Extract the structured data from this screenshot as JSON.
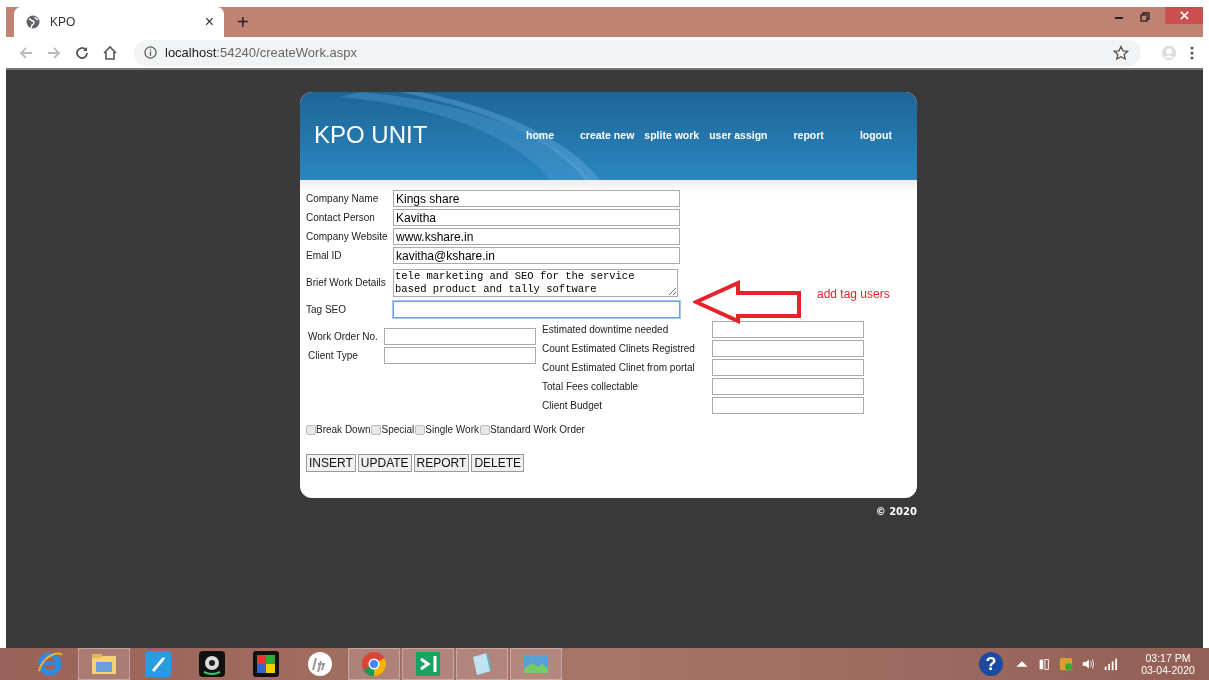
{
  "browser": {
    "tab": {
      "title": "KPO",
      "close": "×"
    },
    "new_tab": "+",
    "address": {
      "host": "localhost",
      "path": ":54240/createWork.aspx"
    }
  },
  "header": {
    "title": "KPO UNIT",
    "nav": [
      {
        "label": "home"
      },
      {
        "label": "create new"
      },
      {
        "label": "splite work"
      },
      {
        "label": "user assign"
      },
      {
        "label": "report"
      },
      {
        "label": "logout"
      }
    ]
  },
  "main_fields": [
    {
      "label": "Company Name",
      "kind": "input",
      "value": "Kings share",
      "focused": false
    },
    {
      "label": "Contact Person",
      "kind": "input",
      "value": "Kavitha",
      "focused": false
    },
    {
      "label": "Company Website",
      "kind": "input",
      "value": "www.kshare.in",
      "focused": false
    },
    {
      "label": "Emal ID",
      "kind": "input",
      "value": "kavitha@kshare.in",
      "focused": false
    },
    {
      "label": "Brief Work Details",
      "kind": "textarea",
      "value": "tele marketing and SEO for the service\nbased product and tally software",
      "focused": false
    },
    {
      "label": "Tag SEO",
      "kind": "input",
      "focused": true
    }
  ],
  "annotation": {
    "text": "add tag users"
  },
  "order_fields": [
    {
      "label": "Work Order No."
    },
    {
      "label": "Client Type"
    }
  ],
  "estimate_fields": [
    {
      "label": "Estimated downtime needed"
    },
    {
      "label": "Count Estimated Clinets Registred"
    },
    {
      "label": "Count Estimated Clinet from portal"
    },
    {
      "label": "Total Fees collectable"
    },
    {
      "label": "Client Budget"
    }
  ],
  "checkboxes": [
    {
      "label": "Break Down",
      "checked": false
    },
    {
      "label": "Special",
      "checked": false
    },
    {
      "label": "Single Work",
      "checked": false
    },
    {
      "label": "Standard Work Order",
      "checked": false
    }
  ],
  "buttons": [
    "INSERT",
    "UPDATE",
    "REPORT",
    "DELETE"
  ],
  "footer": "© 2020",
  "taskbar": {
    "help": "?",
    "time": "03:17 PM",
    "date": "03-04-2020"
  }
}
